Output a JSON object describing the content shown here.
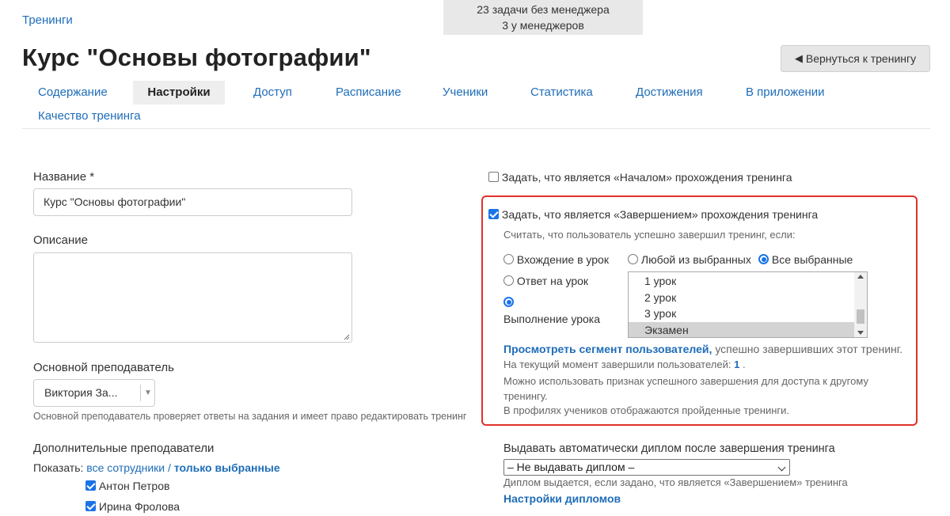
{
  "breadcrumb": "Тренинги",
  "tasks": {
    "line1": "23 задачи без менеджера",
    "line2": "3 у менеджеров"
  },
  "page_title": "Курс \"Основы фотографии\"",
  "back_button": "Вернуться к тренингу",
  "tabs": [
    "Содержание",
    "Настройки",
    "Доступ",
    "Расписание",
    "Ученики",
    "Статистика",
    "Достижения",
    "В приложении",
    "Качество тренинга"
  ],
  "active_tab": "Настройки",
  "form": {
    "name_label": "Название *",
    "name_value": "Курс \"Основы фотографии\"",
    "description_label": "Описание",
    "teacher_label": "Основной преподаватель",
    "teacher_value": "Виктория За...",
    "teacher_hint": "Основной преподаватель проверяет ответы на задания и имеет право редактировать тренинг",
    "extra_teachers_label": "Дополнительные преподаватели",
    "show_label": "Показать:",
    "show_all": "все сотрудники",
    "show_sep": "/",
    "show_selected": "только выбранные",
    "teachers": [
      {
        "name": "Антон Петров",
        "checked": true
      },
      {
        "name": "Ирина Фролова",
        "checked": true
      }
    ]
  },
  "start_checkbox": {
    "label": "Задать, что является «Началом» прохождения тренинга",
    "checked": false
  },
  "completion": {
    "checkbox_label": "Задать, что является «Завершением» прохождения тренинга",
    "checked": true,
    "condition_text": "Считать, что пользователь успешно завершил тренинг, если:",
    "radios_type": [
      {
        "label": "Вхождение в урок",
        "checked": false
      },
      {
        "label": "Ответ на урок",
        "checked": false
      },
      {
        "label": "Выполнение урока",
        "checked": true
      }
    ],
    "radios_mode": [
      {
        "label": "Любой из выбранных",
        "checked": false
      },
      {
        "label": "Все выбранные",
        "checked": true
      }
    ],
    "lessons": [
      "1 урок",
      "2 урок",
      "3 урок",
      "Экзамен"
    ],
    "selected_lesson": "Экзамен",
    "segment_link": "Просмотреть сегмент пользователей,",
    "segment_rest": "успешно завершивших этот тренинг.",
    "current_prefix": "На текущий момент завершили пользователей:",
    "current_count": "1",
    "current_suffix": ".",
    "info1": "Можно использовать признак успешного завершения для доступа к другому тренингу.",
    "info2": "В профилях учеников отображаются пройденные тренинги."
  },
  "diploma": {
    "label": "Выдавать автоматически диплом после завершения тренинга",
    "selected": "– Не выдавать диплом –",
    "hint": "Диплом выдается, если задано, что является «Завершением» тренинга",
    "settings_link": "Настройки дипломов"
  },
  "colors": {
    "link": "#1e6db8",
    "highlight_border": "#e0312b",
    "accent": "#1a73e8"
  }
}
